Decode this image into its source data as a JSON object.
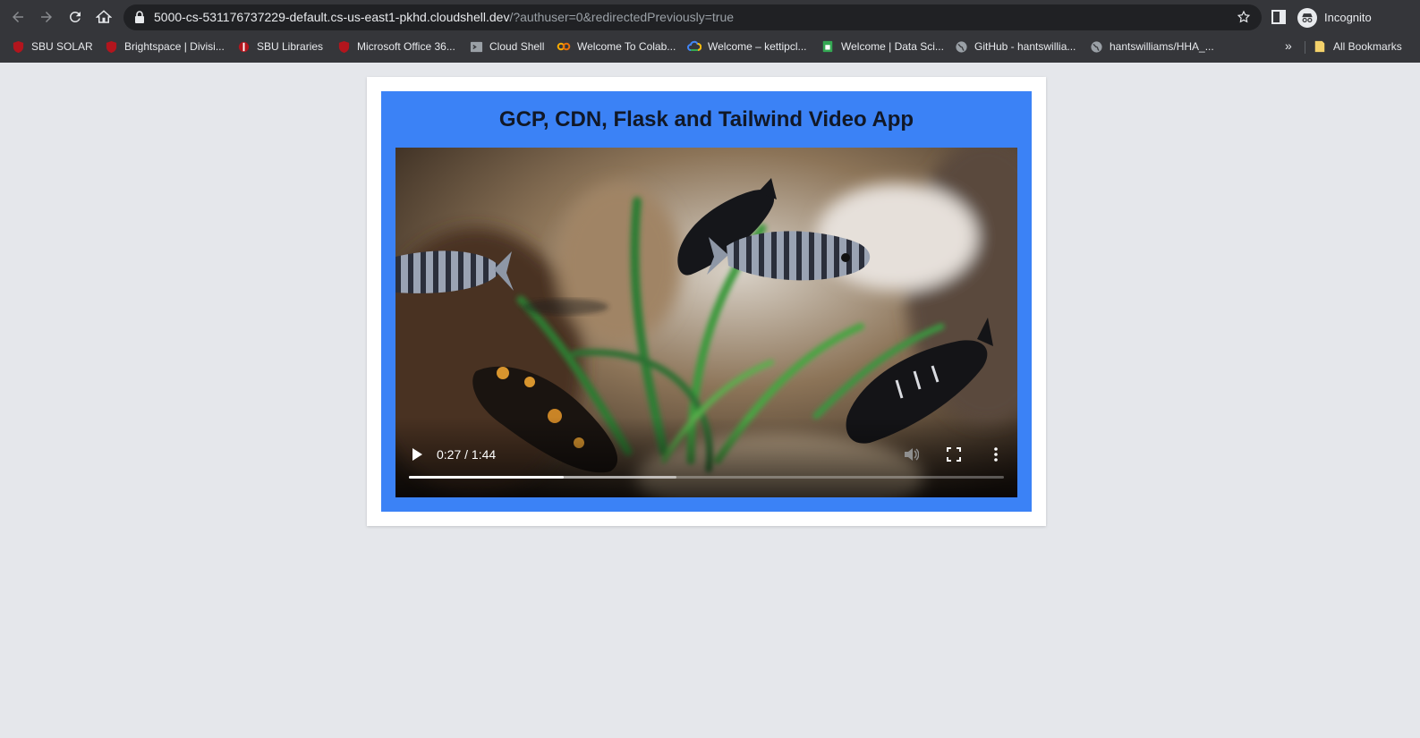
{
  "browser": {
    "url_main": "5000-cs-531176737229-default.cs-us-east1-pkhd.cloudshell.dev",
    "url_query": "/?authuser=0&redirectedPreviously=true",
    "profile_label": "Incognito",
    "bookmarks": [
      {
        "label": "SBU SOLAR",
        "icon": "shield-icon"
      },
      {
        "label": "Brightspace | Divisi...",
        "icon": "shield-icon"
      },
      {
        "label": "SBU Libraries",
        "icon": "torch-icon"
      },
      {
        "label": "Microsoft Office 36...",
        "icon": "shield-icon"
      },
      {
        "label": "Cloud Shell",
        "icon": "terminal-icon"
      },
      {
        "label": "Welcome To Colab...",
        "icon": "colab-icon"
      },
      {
        "label": "Welcome – kettipcl...",
        "icon": "cloud-icon"
      },
      {
        "label": "Welcome | Data Sci...",
        "icon": "sheet-icon"
      },
      {
        "label": "GitHub - hantswillia...",
        "icon": "globe-icon"
      },
      {
        "label": "hantswilliams/HHA_...",
        "icon": "globe-icon"
      }
    ],
    "overflow_label": "»",
    "all_bookmarks_label": "All Bookmarks"
  },
  "page": {
    "title": "GCP, CDN, Flask and Tailwind Video App"
  },
  "video": {
    "time_display": "0:27 / 1:44",
    "current_seconds": 27,
    "duration_seconds": 104,
    "buffered_fraction": 0.45
  },
  "colors": {
    "panel": "#3b82f6",
    "page_bg": "#e5e7eb",
    "card": "#ffffff",
    "chrome": "#35363a"
  }
}
